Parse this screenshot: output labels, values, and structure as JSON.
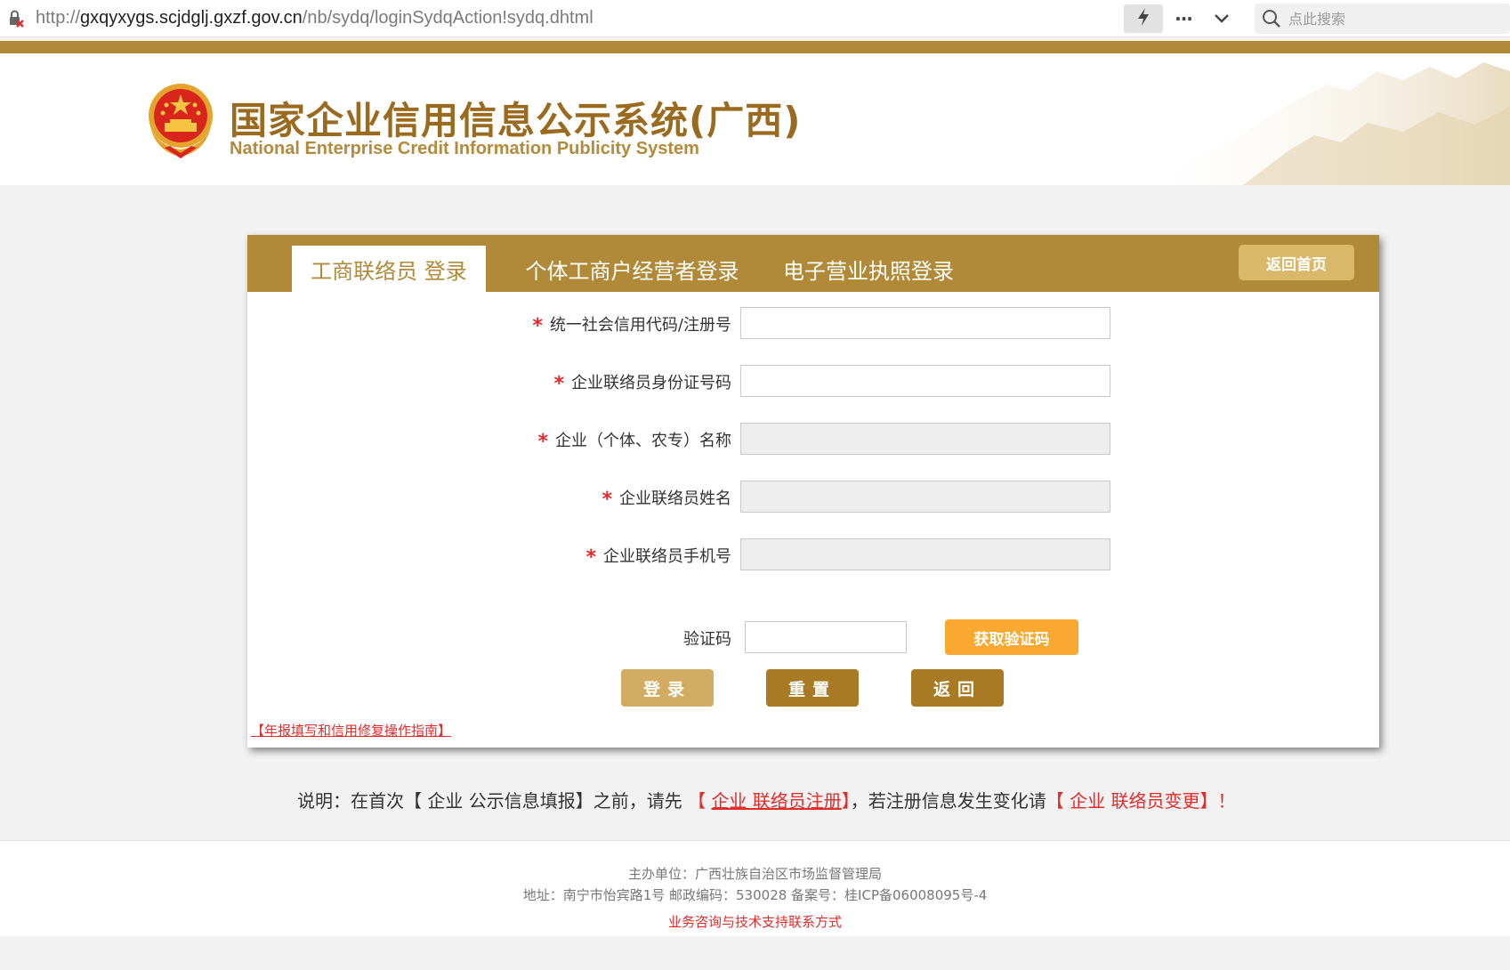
{
  "browser": {
    "url_scheme": "http://",
    "url_host": "gxqyxygs.scjdglj.gxzf.gov.cn",
    "url_path": "/nb/sydq/loginSydqAction!sydq.dhtml",
    "more_label": "···",
    "search_placeholder": "点此搜索"
  },
  "header": {
    "title_cn": "国家企业信用信息公示系统(广西)",
    "title_en": "National Enterprise Credit Information Publicity System"
  },
  "panel": {
    "tabs": [
      {
        "label": "工商联络员 登录",
        "active": true
      },
      {
        "label": "个体工商户经营者登录",
        "active": false
      },
      {
        "label": "电子营业执照登录",
        "active": false
      }
    ],
    "home_button": "返回首页",
    "fields": [
      {
        "star": "*",
        "label": "统一社会信用代码/注册号",
        "value": "",
        "disabled": false
      },
      {
        "star": "*",
        "label": "企业联络员身份证号码",
        "value": "",
        "disabled": false
      },
      {
        "star": "*",
        "label": "企业（个体、农专）名称",
        "value": "",
        "disabled": true
      },
      {
        "star": "*",
        "label": "企业联络员姓名",
        "value": "",
        "disabled": true
      },
      {
        "star": "*",
        "label": "企业联络员手机号",
        "value": "",
        "disabled": true
      }
    ],
    "code_label": "验证码",
    "code_value": "",
    "get_code_button": "获取验证码",
    "login_button": "登录",
    "reset_button": "重置",
    "back_button": "返回",
    "guide_link": "【年报填写和信用修复操作指南】"
  },
  "note": {
    "prefix": "说明：在首次【 企业 公示信息填报】之前，请先 ",
    "register_open": "【 ",
    "register_link": "企业 联络员注册",
    "register_close": "】",
    "middle": "，若注册信息发生变化请",
    "change_text": "【 企业 联络员变更】！"
  },
  "footer": {
    "line1": "主办单位：广西壮族自治区市场监督管理局",
    "line2": "地址：南宁市怡宾路1号 邮政编码：530028    备案号：桂ICP备06008095号-4",
    "line3": "业务咨询与技术支持联系方式"
  },
  "colors": {
    "gold": "#b08a38",
    "gold_light": "#d9b86a",
    "orange": "#f9a931",
    "red": "#e32b2b"
  }
}
